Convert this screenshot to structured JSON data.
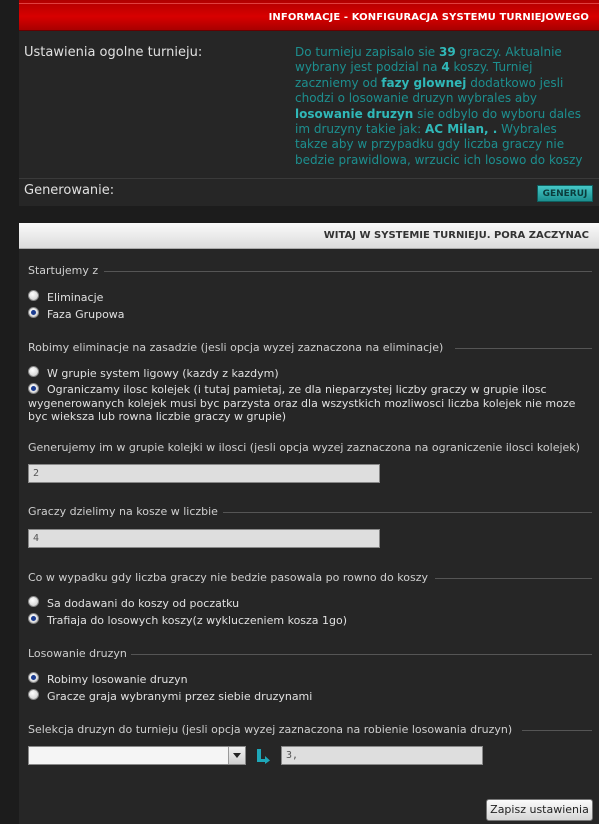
{
  "header": {
    "title": "INFORMACJE - KONFIGURACJA SYSTEMU TURNIEJOWEGO"
  },
  "general": {
    "label": "Ustawienia ogolne turnieju:",
    "desc": {
      "p1": "Do turnieju zapisalo sie ",
      "players": "39",
      "p2": " graczy. Aktualnie wybrany jest podzial na ",
      "baskets": "4",
      "p3": " koszy. Turniej zaczniemy od ",
      "phase": "fazy glownej",
      "p4": " dodatkowo jesli chodzi o losowanie druzyn wybrales aby ",
      "draw": "losowanie druzyn",
      "p5": " sie odbylo do wyboru dales im druzyny takie jak: ",
      "teams": "AC Milan, .",
      "p6": " Wybrales takze aby w przypadku gdy liczba graczy nie bedzie prawidlowa, wrzucic ich losowo do koszy"
    }
  },
  "generate": {
    "label": "Generowanie:",
    "button": "GENERUJ"
  },
  "welcome": {
    "title": "WITAJ W SYSTEMIE TURNIEJU. PORA ZACZYNAC"
  },
  "start": {
    "legend": "Startujemy z",
    "options": [
      "Eliminacje",
      "Faza Grupowa"
    ],
    "selected": 1
  },
  "elimination": {
    "legend": "Robimy eliminacje na zasadzie (jesli opcja wyzej zaznaczona na eliminacje)",
    "options": [
      "W grupie system ligowy (kazdy z kazdym)",
      "Ograniczamy ilosc kolejek (i tutaj pamietaj, ze dla nieparzystej liczby graczy w grupie ilosc wygenerowanych kolejek musi byc parzysta oraz dla wszystkich mozliwosci liczba kolejek nie moze byc wieksza lub rowna liczbie graczy w grupie)"
    ],
    "selected": 1
  },
  "rounds": {
    "legend": "Generujemy im w grupie kolejki w ilosci (jesli opcja wyzej zaznaczona na ograniczenie ilosci kolejek)",
    "value": "2"
  },
  "baskets": {
    "legend": "Graczy dzielimy na kosze w liczbie",
    "value": "4"
  },
  "uneven": {
    "legend": "Co w wypadku gdy liczba graczy nie bedzie pasowala po rowno do koszy",
    "options": [
      "Sa dodawani do koszy od poczatku",
      "Trafiaja do losowych koszy(z wykluczeniem kosza 1go)"
    ],
    "selected": 1
  },
  "draw": {
    "legend": "Losowanie druzyn",
    "options": [
      "Robimy losowanie druzyn",
      "Gracze graja wybranymi przez siebie druzynami"
    ],
    "selected": 0
  },
  "teams": {
    "legend": "Selekcja druzyn do turnieju (jesli opcja wyzej zaznaczona na robienie losowania druzyn)",
    "select_value": "",
    "selected_list": "3,"
  },
  "save_button": "Zapisz ustawienia",
  "colors": {
    "header_red": "#d80000",
    "teal_text": "#1d8f8f",
    "teal_button": "#2aa9a9"
  }
}
